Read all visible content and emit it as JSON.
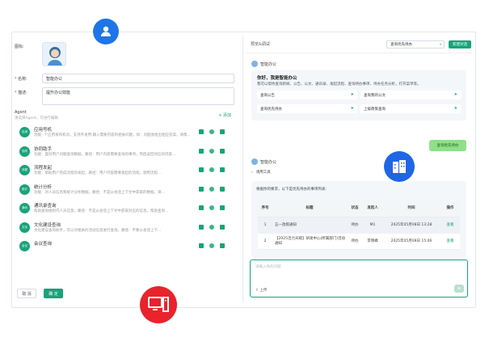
{
  "left": {
    "avatar_label": "图标:",
    "name_label": "名称:",
    "name_value": "智能办公",
    "desc_label": "描述:",
    "desc_value": "提升办公效能",
    "agent_title": "Agent",
    "agent_sub": "请选择Agent，可进行编辑",
    "add_label": "+ 添加",
    "agents": [
      {
        "name": "应用号机",
        "icon": "应用",
        "desc": "功能：·个应用发布机问，支持开发用·输入需要内容的相关问题，如：问题会给出相应答案，请帮..."
      },
      {
        "name": "协同助手",
        "icon": "协同",
        "desc": "功能：面对用户问题查询数据，路径：用户内容需要查询的事项，然后返回对应的内容..."
      },
      {
        "name": "流程发起",
        "icon": "流程",
        "desc": "功能：帮助用户完成流程的发起，路径：用户内容需要发起的流程，调用流程..."
      },
      {
        "name": "统计分析",
        "icon": "统计",
        "desc": "功能：对人员信息和统计分析数据，路径：不是从会话上下文中获取的数据，请..."
      },
      {
        "name": "通讯录查询",
        "icon": "通讯",
        "desc": "帮助查询组织内人员信息，路径：不是从会话上下文中获取对应的信息，帮助查询..."
      },
      {
        "name": "文化建设查询",
        "icon": "文化",
        "desc": "文化建设查询助手，可以对相关的活动信息进行查询，路径：不要从会话上下..."
      },
      {
        "name": "会议查询",
        "icon": "会议",
        "desc": ""
      }
    ],
    "cancel_label": "取 消",
    "ok_label": "确 定"
  },
  "right": {
    "title": "预览&调试",
    "select_value": "查询优先待办",
    "new_chat_label": "新建对话",
    "bot_name": "智能办公",
    "welcome_title": "你好，我是智能办公",
    "welcome_desc": "我可以帮你查询新闻、公告、公文、通讯录、发起流程、查询待办事项、待办任务分析，打开菜单等。",
    "suggestions": [
      "查询公告",
      "查询我的公文",
      "查询优先待办",
      "上级政策查询"
    ],
    "user_msg": "查询优先待办",
    "tool_label": "调用工具",
    "answer_intro": "根据你的要求，以下是优先待办的事项列表：",
    "table_headers": [
      "序号",
      "标题",
      "状态",
      "发起人",
      "时间",
      "操作"
    ],
    "table_rows": [
      {
        "no": "1",
        "title": "五一放假通知",
        "status": "待办",
        "sender": "M1",
        "time": "2025年05月08日 13:28",
        "op": "查看"
      },
      {
        "no": "2",
        "title": "【2025活力天赋】研发中心(所属部门)活动通知",
        "status": "待办",
        "sender": "李晓峰",
        "time": "2025年05月08日 15:06",
        "op": "查看"
      }
    ],
    "input_placeholder": "请输入你的问题",
    "upload_label": "上传"
  }
}
